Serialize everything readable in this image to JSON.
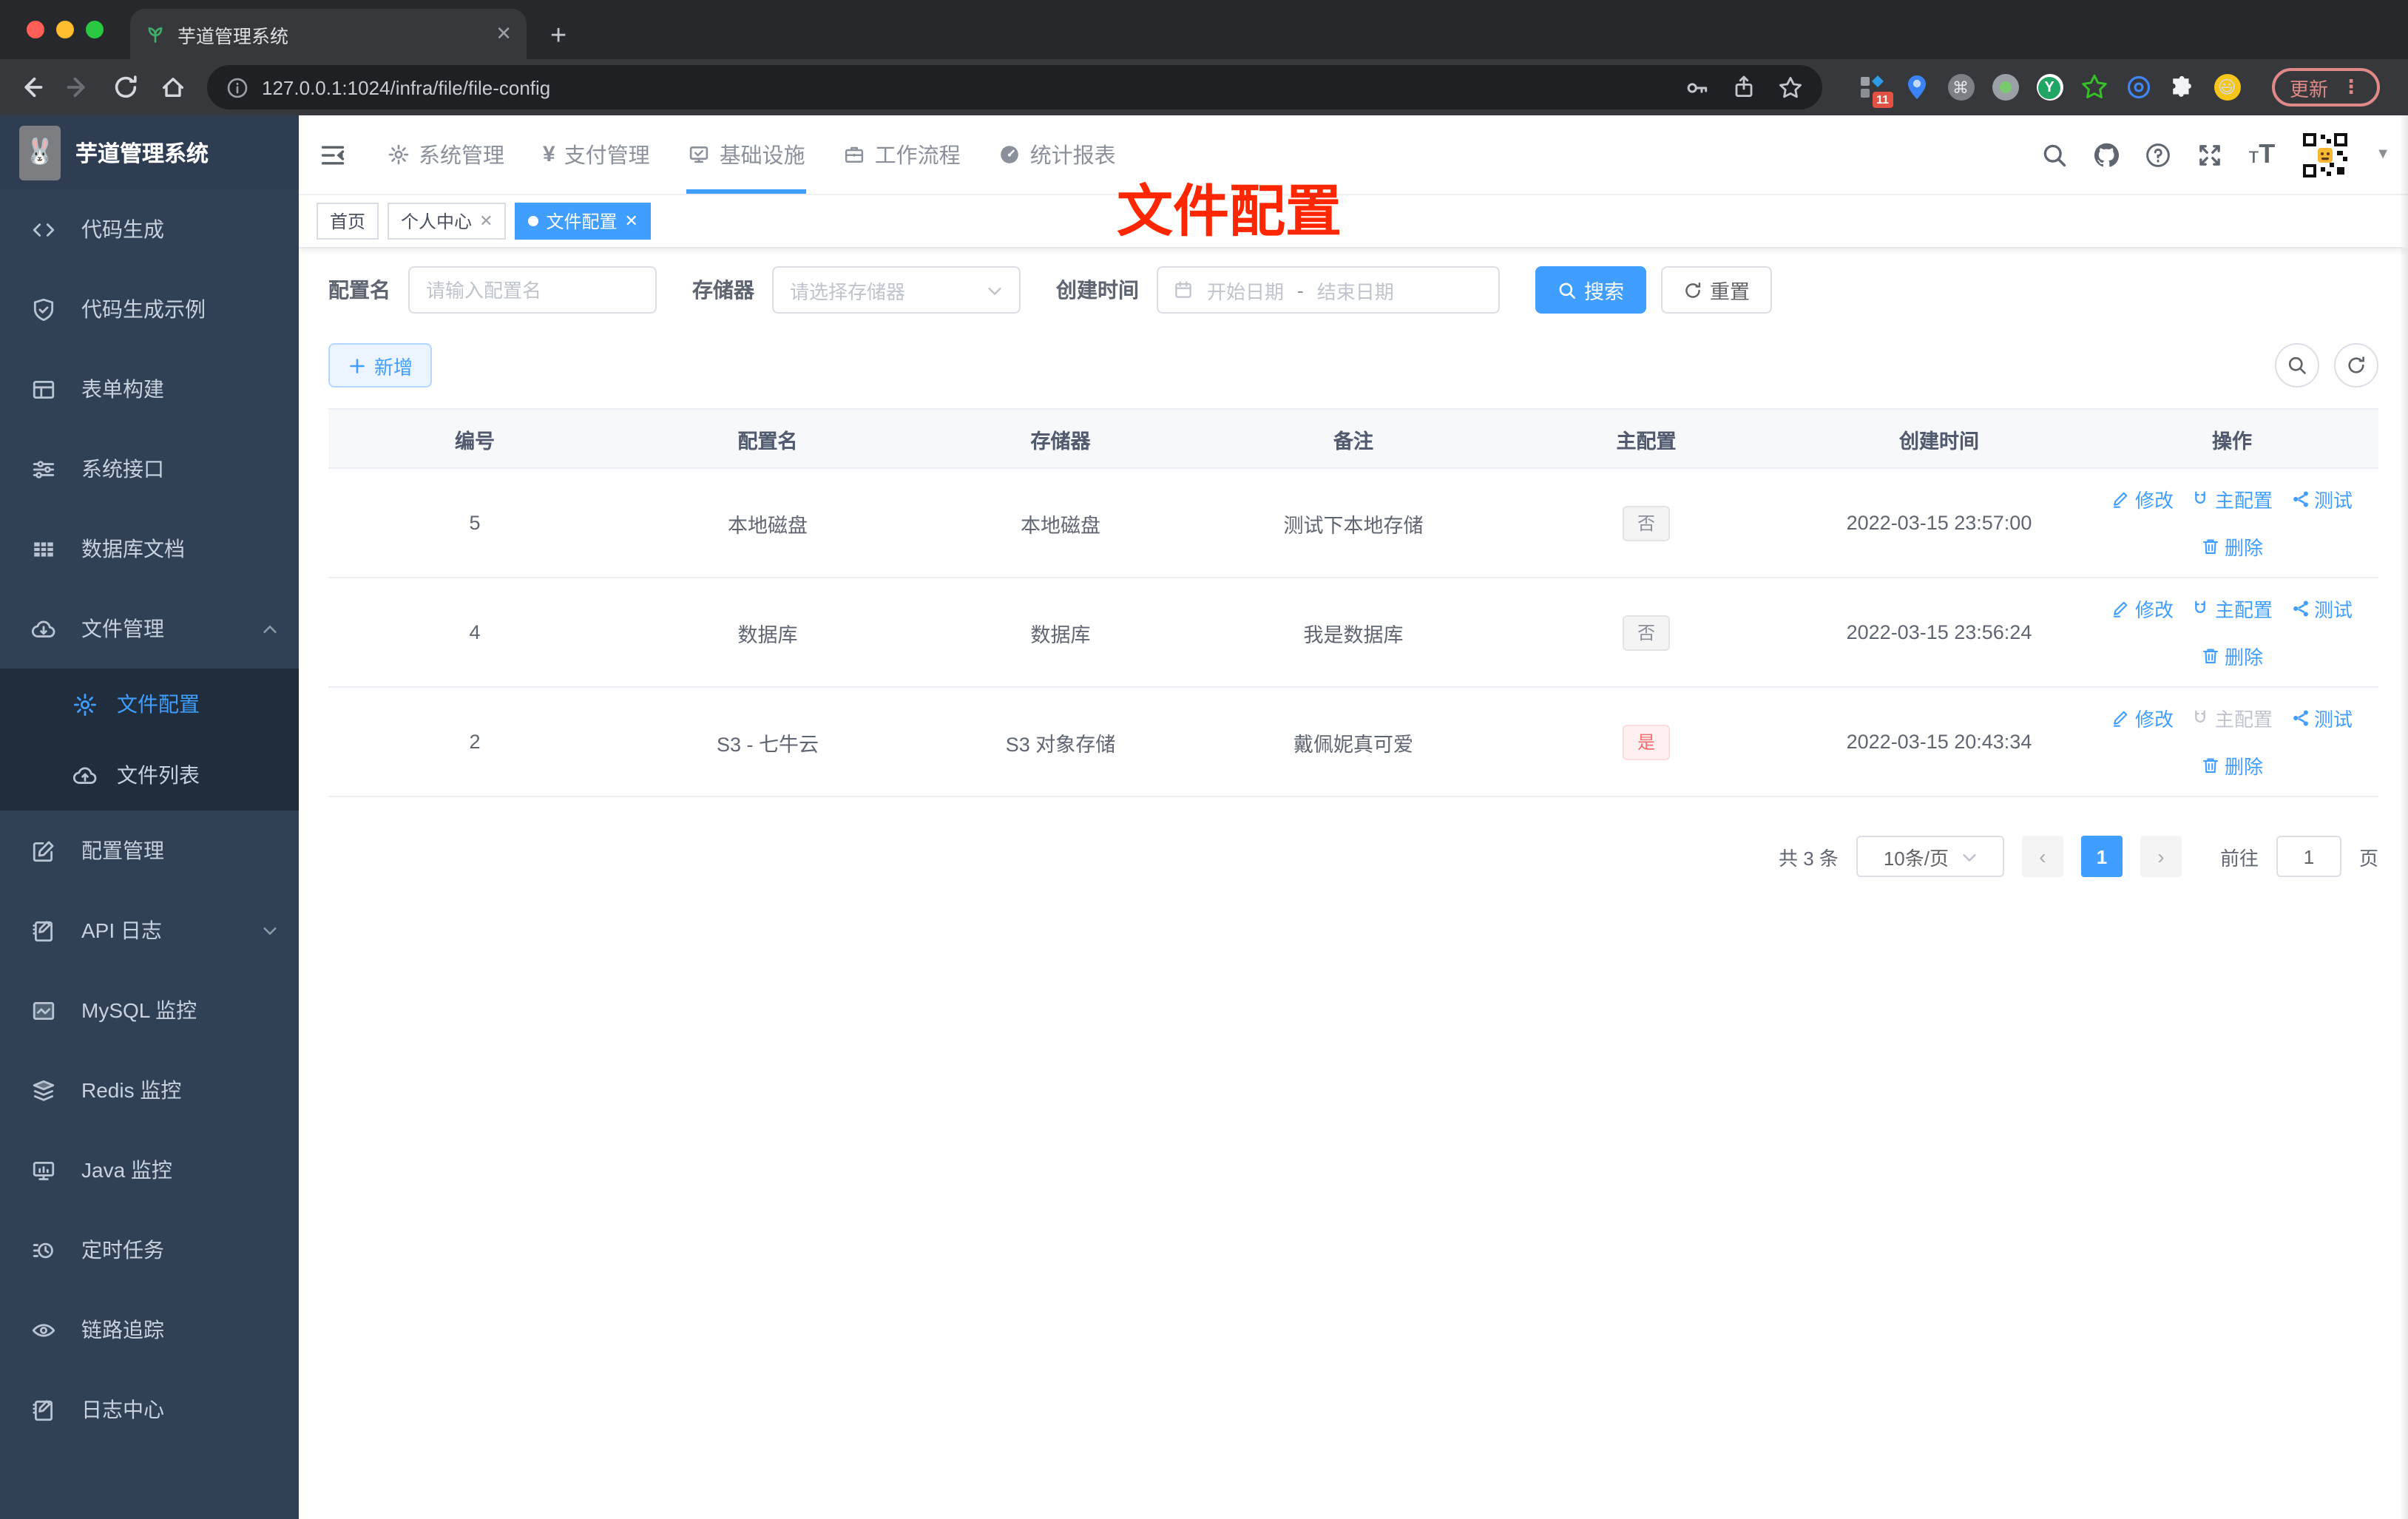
{
  "browser": {
    "tab_title": "芋道管理系统",
    "url": "127.0.0.1:1024/infra/file/file-config",
    "extension_badge": "11",
    "update_label": "更新"
  },
  "colors": {
    "accent": "#409eff",
    "danger": "#f56c6c",
    "annotation_red": "#ff2600",
    "sidebar_bg": "#304156",
    "submenu_bg": "#1f2d3d"
  },
  "app": {
    "logo_title": "芋道管理系统",
    "annotation": "文件配置",
    "top_nav": [
      {
        "icon": "gear-icon",
        "label": "系统管理"
      },
      {
        "icon": "yen-icon",
        "label": "支付管理"
      },
      {
        "icon": "monitor-check-icon",
        "label": "基础设施",
        "active": true
      },
      {
        "icon": "briefcase-icon",
        "label": "工作流程"
      },
      {
        "icon": "gauge-icon",
        "label": "统计报表"
      }
    ],
    "tags": [
      {
        "label": "首页"
      },
      {
        "label": "个人中心",
        "closable": true
      },
      {
        "label": "文件配置",
        "closable": true,
        "active": true
      }
    ]
  },
  "sidebar": {
    "items": [
      {
        "icon": "code-icon",
        "label": "代码生成"
      },
      {
        "icon": "shield-check-icon",
        "label": "代码生成示例"
      },
      {
        "icon": "form-icon",
        "label": "表单构建"
      },
      {
        "icon": "sliders-icon",
        "label": "系统接口"
      },
      {
        "icon": "table-icon",
        "label": "数据库文档"
      },
      {
        "icon": "cloud-download-icon",
        "label": "文件管理",
        "expanded": true,
        "children": [
          {
            "icon": "gear-icon",
            "label": "文件配置",
            "active": true
          },
          {
            "icon": "cloud-upload-icon",
            "label": "文件列表"
          }
        ]
      },
      {
        "icon": "edit-square-icon",
        "label": "配置管理"
      },
      {
        "icon": "doc-edit-icon",
        "label": "API 日志",
        "collapsed": true
      },
      {
        "icon": "chart-icon",
        "label": "MySQL 监控"
      },
      {
        "icon": "layers-icon",
        "label": "Redis 监控"
      },
      {
        "icon": "monitor-icon",
        "label": "Java 监控"
      },
      {
        "icon": "schedule-icon",
        "label": "定时任务"
      },
      {
        "icon": "eye-icon",
        "label": "链路追踪"
      },
      {
        "icon": "doc-edit-icon",
        "label": "日志中心"
      }
    ]
  },
  "filters": {
    "config_name_label": "配置名",
    "config_name_placeholder": "请输入配置名",
    "storage_label": "存储器",
    "storage_placeholder": "请选择存储器",
    "create_time_label": "创建时间",
    "date_start_placeholder": "开始日期",
    "date_separator": "-",
    "date_end_placeholder": "结束日期",
    "search_label": "搜索",
    "reset_label": "重置"
  },
  "toolbar": {
    "add_label": "新增"
  },
  "table": {
    "headers": [
      "编号",
      "配置名",
      "存储器",
      "备注",
      "主配置",
      "创建时间",
      "操作"
    ],
    "rows": [
      {
        "id": "5",
        "name": "本地磁盘",
        "storage": "本地磁盘",
        "remark": "测试下本地存储",
        "master": "否",
        "master_type": "info",
        "created": "2022-03-15 23:57:00",
        "master_action_disabled": false
      },
      {
        "id": "4",
        "name": "数据库",
        "storage": "数据库",
        "remark": "我是数据库",
        "master": "否",
        "master_type": "info",
        "created": "2022-03-15 23:56:24",
        "master_action_disabled": false
      },
      {
        "id": "2",
        "name": "S3 - 七牛云",
        "storage": "S3 对象存储",
        "remark": "戴佩妮真可爱",
        "master": "是",
        "master_type": "danger",
        "created": "2022-03-15 20:43:34",
        "master_action_disabled": true
      }
    ],
    "actions": {
      "edit": "修改",
      "master": "主配置",
      "test": "测试",
      "delete": "删除"
    }
  },
  "pagination": {
    "total": "共 3 条",
    "page_size": "10条/页",
    "current_page": "1",
    "goto_label": "前往",
    "goto_value": "1",
    "page_unit": "页"
  }
}
